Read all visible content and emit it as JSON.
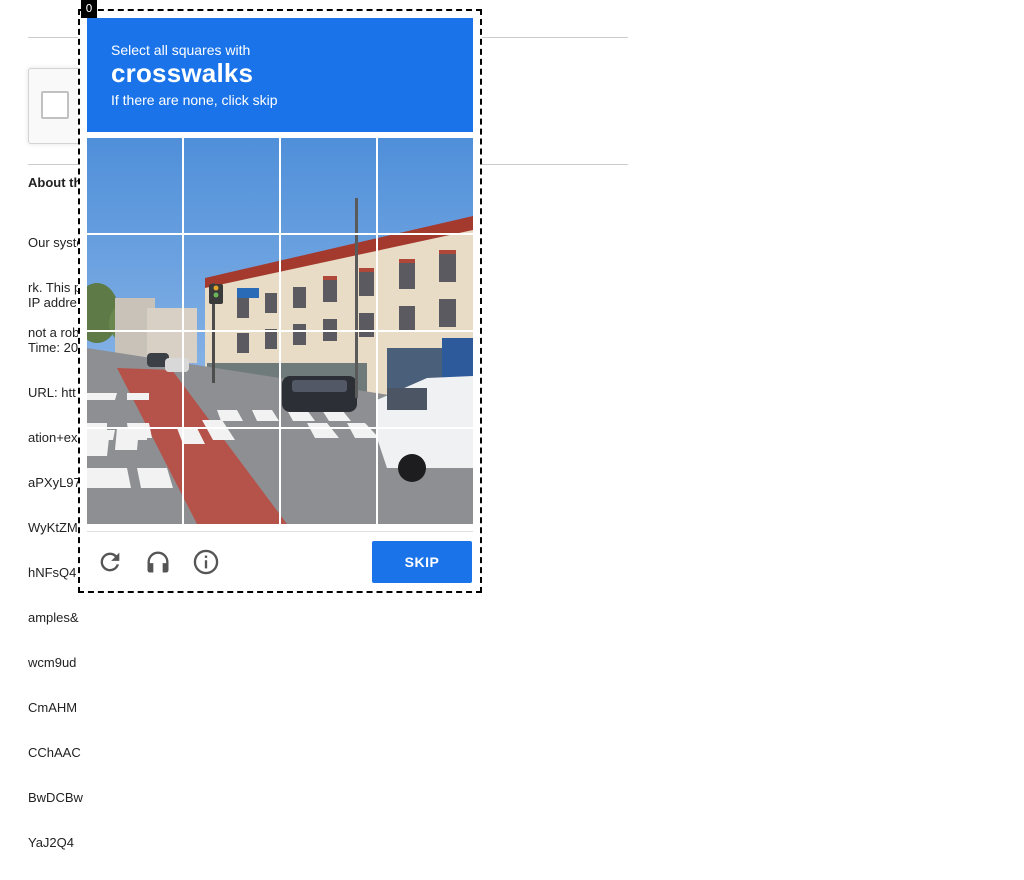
{
  "background_page": {
    "about_heading": "About th",
    "paragraph_lines": [
      "Our syste",
      "rk. This p",
      "not a rob"
    ],
    "info_lines": [
      "IP addre",
      "Time: 20",
      "URL: htt",
      "ation+ex",
      "aPXyL97",
      "WyKtZM",
      "hNFsQ4",
      "amples&",
      "wcm9ud",
      "CmAHM",
      "CChAAC",
      "BwDCBw",
      "YaJ2Q4"
    ]
  },
  "challenge": {
    "badge_number": "0",
    "instruction": "Select all squares with",
    "target": "crosswalks",
    "hint": "If there are none, click skip",
    "grid_rows": 4,
    "grid_cols": 4,
    "skip_label": "SKIP",
    "icons": [
      "reload-icon",
      "headphones-icon",
      "info-icon"
    ],
    "accent_color": "#1a73e8"
  }
}
